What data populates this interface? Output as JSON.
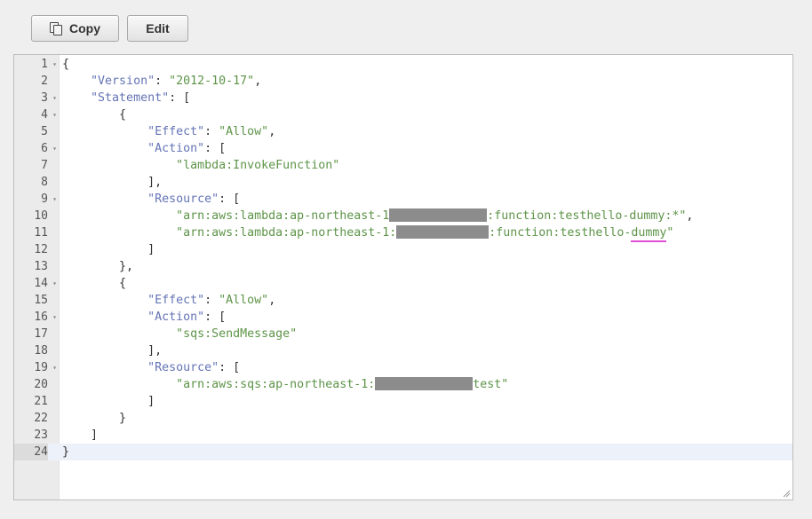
{
  "toolbar": {
    "copy_label": "Copy",
    "edit_label": "Edit"
  },
  "editor": {
    "active_line": 24,
    "lines": [
      {
        "n": "1",
        "fold": true,
        "parts": [
          {
            "t": "{",
            "c": "p"
          }
        ]
      },
      {
        "n": "2",
        "fold": false,
        "parts": [
          {
            "t": "    ",
            "c": "p"
          },
          {
            "t": "\"Version\"",
            "c": "k"
          },
          {
            "t": ": ",
            "c": "p"
          },
          {
            "t": "\"2012-10-17\"",
            "c": "s"
          },
          {
            "t": ",",
            "c": "p"
          }
        ]
      },
      {
        "n": "3",
        "fold": true,
        "parts": [
          {
            "t": "    ",
            "c": "p"
          },
          {
            "t": "\"Statement\"",
            "c": "k"
          },
          {
            "t": ": [",
            "c": "p"
          }
        ]
      },
      {
        "n": "4",
        "fold": true,
        "parts": [
          {
            "t": "        {",
            "c": "p"
          }
        ]
      },
      {
        "n": "5",
        "fold": false,
        "parts": [
          {
            "t": "            ",
            "c": "p"
          },
          {
            "t": "\"Effect\"",
            "c": "k"
          },
          {
            "t": ": ",
            "c": "p"
          },
          {
            "t": "\"Allow\"",
            "c": "s"
          },
          {
            "t": ",",
            "c": "p"
          }
        ]
      },
      {
        "n": "6",
        "fold": true,
        "parts": [
          {
            "t": "            ",
            "c": "p"
          },
          {
            "t": "\"Action\"",
            "c": "k"
          },
          {
            "t": ": [",
            "c": "p"
          }
        ]
      },
      {
        "n": "7",
        "fold": false,
        "parts": [
          {
            "t": "                ",
            "c": "p"
          },
          {
            "t": "\"lambda:InvokeFunction\"",
            "c": "s"
          }
        ]
      },
      {
        "n": "8",
        "fold": false,
        "parts": [
          {
            "t": "            ],",
            "c": "p"
          }
        ]
      },
      {
        "n": "9",
        "fold": true,
        "parts": [
          {
            "t": "            ",
            "c": "p"
          },
          {
            "t": "\"Resource\"",
            "c": "k"
          },
          {
            "t": ": [",
            "c": "p"
          }
        ]
      },
      {
        "n": "10",
        "fold": false,
        "parts": [
          {
            "t": "                ",
            "c": "p"
          },
          {
            "t": "\"arn:aws:lambda:ap-northeast-1",
            "c": "s"
          },
          {
            "r": 110
          },
          {
            "t": ":function:testhello-dummy:*\"",
            "c": "s"
          },
          {
            "t": ",",
            "c": "p"
          }
        ]
      },
      {
        "n": "11",
        "fold": false,
        "parts": [
          {
            "t": "                ",
            "c": "p"
          },
          {
            "t": "\"arn:aws:lambda:ap-northeast-1:",
            "c": "s"
          },
          {
            "r": 104
          },
          {
            "t": ":function:testhello-",
            "c": "s"
          },
          {
            "t": "dummy",
            "c": "s",
            "u": true
          },
          {
            "t": "\"",
            "c": "s"
          }
        ]
      },
      {
        "n": "12",
        "fold": false,
        "parts": [
          {
            "t": "            ]",
            "c": "p"
          }
        ]
      },
      {
        "n": "13",
        "fold": false,
        "parts": [
          {
            "t": "        },",
            "c": "p"
          }
        ]
      },
      {
        "n": "14",
        "fold": true,
        "parts": [
          {
            "t": "        {",
            "c": "p"
          }
        ]
      },
      {
        "n": "15",
        "fold": false,
        "parts": [
          {
            "t": "            ",
            "c": "p"
          },
          {
            "t": "\"Effect\"",
            "c": "k"
          },
          {
            "t": ": ",
            "c": "p"
          },
          {
            "t": "\"Allow\"",
            "c": "s"
          },
          {
            "t": ",",
            "c": "p"
          }
        ]
      },
      {
        "n": "16",
        "fold": true,
        "parts": [
          {
            "t": "            ",
            "c": "p"
          },
          {
            "t": "\"Action\"",
            "c": "k"
          },
          {
            "t": ": [",
            "c": "p"
          }
        ]
      },
      {
        "n": "17",
        "fold": false,
        "parts": [
          {
            "t": "                ",
            "c": "p"
          },
          {
            "t": "\"sqs:SendMessage\"",
            "c": "s"
          }
        ]
      },
      {
        "n": "18",
        "fold": false,
        "parts": [
          {
            "t": "            ],",
            "c": "p"
          }
        ]
      },
      {
        "n": "19",
        "fold": true,
        "parts": [
          {
            "t": "            ",
            "c": "p"
          },
          {
            "t": "\"Resource\"",
            "c": "k"
          },
          {
            "t": ": [",
            "c": "p"
          }
        ]
      },
      {
        "n": "20",
        "fold": false,
        "parts": [
          {
            "t": "                ",
            "c": "p"
          },
          {
            "t": "\"arn:aws:sqs:ap-northeast-1:",
            "c": "s"
          },
          {
            "r": 110
          },
          {
            "t": "test\"",
            "c": "s"
          }
        ]
      },
      {
        "n": "21",
        "fold": false,
        "parts": [
          {
            "t": "            ]",
            "c": "p"
          }
        ]
      },
      {
        "n": "22",
        "fold": false,
        "parts": [
          {
            "t": "        }",
            "c": "p"
          }
        ]
      },
      {
        "n": "23",
        "fold": false,
        "parts": [
          {
            "t": "    ]",
            "c": "p"
          }
        ]
      },
      {
        "n": "24",
        "fold": false,
        "parts": [
          {
            "t": "}",
            "c": "p"
          }
        ]
      }
    ]
  }
}
